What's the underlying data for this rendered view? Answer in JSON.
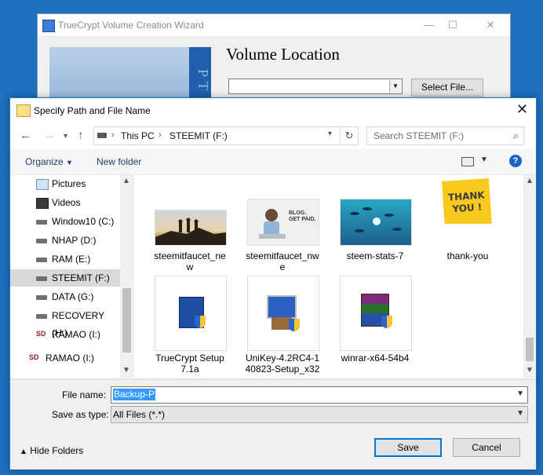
{
  "back_window": {
    "title": "TrueCrypt Volume Creation Wizard",
    "banner_text": "PT",
    "heading": "Volume Location",
    "select_file_label": "Select File..."
  },
  "dialog": {
    "title": "Specify Path and File Name",
    "breadcrumb": [
      "This PC",
      "STEEMIT (F:)"
    ],
    "search_placeholder": "Search STEEMIT (F:)",
    "toolbar": {
      "organize": "Organize",
      "new_folder": "New folder",
      "help": "?"
    },
    "nav_items": [
      {
        "label": "Pictures",
        "icon": "pictures-icon"
      },
      {
        "label": "Videos",
        "icon": "videos-icon"
      },
      {
        "label": "Window10 (C:)",
        "icon": "drive-icon"
      },
      {
        "label": "NHAP (D:)",
        "icon": "drive-icon"
      },
      {
        "label": "RAM (E:)",
        "icon": "drive-icon"
      },
      {
        "label": "STEEMIT (F:)",
        "icon": "drive-icon",
        "selected": true
      },
      {
        "label": "DATA (G:)",
        "icon": "drive-icon"
      },
      {
        "label": "RECOVERY (H:)",
        "icon": "drive-icon"
      },
      {
        "label": "RAMAO (I:)",
        "icon": "sd-icon"
      },
      {
        "label": "RAMAO (I:)",
        "icon": "sd-icon"
      }
    ],
    "files": [
      {
        "name": "steemitfaucet_new",
        "name_lines": [
          "steemitfaucet_ne",
          "w"
        ],
        "thumb": "silhouette-image"
      },
      {
        "name": "steemitfaucet_nwe",
        "name_lines": [
          "steemitfaucet_nw",
          "e"
        ],
        "thumb": "blog-get-paid-image",
        "thumb_text": [
          "BLOG.",
          "GET PAID."
        ]
      },
      {
        "name": "steem-stats-7",
        "name_lines": [
          "steem-stats-7"
        ],
        "thumb": "fish-image"
      },
      {
        "name": "thank-you",
        "name_lines": [
          "thank-you"
        ],
        "thumb": "sticky-note-image",
        "thumb_text": [
          "THANK",
          "YOU !"
        ]
      },
      {
        "name": "TrueCrypt Setup 7.1a",
        "name_lines": [
          "TrueCrypt Setup",
          "7.1a"
        ],
        "thumb": "truecrypt-installer-icon"
      },
      {
        "name": "UniKey-4.2RC4-140823-Setup_x32",
        "name_lines": [
          "UniKey-4.2RC4-1",
          "40823-Setup_x32"
        ],
        "thumb": "unikey-installer-icon"
      },
      {
        "name": "winrar-x64-54b4",
        "name_lines": [
          "winrar-x64-54b4"
        ],
        "thumb": "winrar-installer-icon"
      }
    ],
    "form": {
      "file_name_label": "File name:",
      "file_name_value": "Backup-P",
      "save_as_type_label": "Save as type:",
      "save_as_type_value": "All Files (*.*)",
      "hide_folders_label": "Hide Folders",
      "save_label": "Save",
      "cancel_label": "Cancel"
    }
  },
  "colors": {
    "desktop": "#1e6fbd",
    "accent": "#0078d7",
    "selection": "#3399ff"
  }
}
